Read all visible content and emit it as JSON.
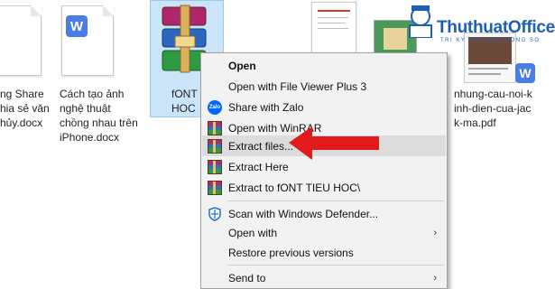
{
  "files": [
    {
      "name": "ng Share\nhia sẻ văn\nhủy.docx"
    },
    {
      "name": "Cách tạo ảnh\nnghệ thuật\nchồng nhau trên\niPhone.docx",
      "badge": "W"
    },
    {
      "name": "fONT\nHOC"
    },
    {
      "name": "nhung-cau-noi-k\ninh-dien-cua-jac\nk-ma.pdf"
    }
  ],
  "brand": {
    "title": "ThuthuatOffice",
    "subtitle": "TRI KY CUA DAN CONG SO"
  },
  "menu": {
    "items": [
      {
        "label": "Open",
        "bold": true
      },
      {
        "label": "Open with File Viewer Plus 3"
      },
      {
        "label": "Share with Zalo"
      },
      {
        "label": "Open with WinRAR"
      },
      {
        "label": "Extract files...",
        "highlight": true
      },
      {
        "label": "Extract Here"
      },
      {
        "label": "Extract to fONT TIEU HOC\\"
      },
      {
        "label": "Scan with Windows Defender..."
      },
      {
        "label": "Open with",
        "submenu": true
      },
      {
        "label": "Restore previous versions"
      },
      {
        "label": "Send to",
        "submenu": true
      }
    ]
  },
  "icons": {
    "zalo": "Zalo",
    "arrow": "›",
    "bottom_badge": "W"
  },
  "colors": {
    "highlight": "#dcdcdc",
    "selection": "#cce4f7",
    "red_arrow": "#e11b1b",
    "brand": "#1d5fb8"
  }
}
